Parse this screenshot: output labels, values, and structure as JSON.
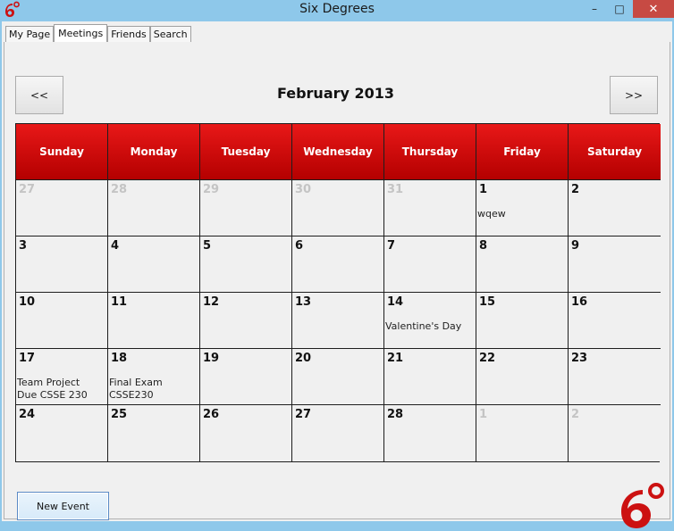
{
  "window": {
    "title": "Six Degrees"
  },
  "colors": {
    "header_red": "#d40c0c",
    "brand_red": "#cc1111"
  },
  "tabs": [
    {
      "label": "My Page",
      "active": false
    },
    {
      "label": "Meetings",
      "active": true
    },
    {
      "label": "Friends",
      "active": false
    },
    {
      "label": "Search",
      "active": false
    }
  ],
  "calendar": {
    "prev_label": "<<",
    "next_label": ">>",
    "month_title": "February 2013",
    "weekdays": [
      "Sunday",
      "Monday",
      "Tuesday",
      "Wednesday",
      "Thursday",
      "Friday",
      "Saturday"
    ],
    "weeks": [
      [
        {
          "day": "27",
          "other": true,
          "event": ""
        },
        {
          "day": "28",
          "other": true,
          "event": ""
        },
        {
          "day": "29",
          "other": true,
          "event": ""
        },
        {
          "day": "30",
          "other": true,
          "event": ""
        },
        {
          "day": "31",
          "other": true,
          "event": ""
        },
        {
          "day": "1",
          "other": false,
          "event": "wqew"
        },
        {
          "day": "2",
          "other": false,
          "event": ""
        }
      ],
      [
        {
          "day": "3",
          "other": false,
          "event": ""
        },
        {
          "day": "4",
          "other": false,
          "event": ""
        },
        {
          "day": "5",
          "other": false,
          "event": ""
        },
        {
          "day": "6",
          "other": false,
          "event": ""
        },
        {
          "day": "7",
          "other": false,
          "event": ""
        },
        {
          "day": "8",
          "other": false,
          "event": ""
        },
        {
          "day": "9",
          "other": false,
          "event": ""
        }
      ],
      [
        {
          "day": "10",
          "other": false,
          "event": ""
        },
        {
          "day": "11",
          "other": false,
          "event": ""
        },
        {
          "day": "12",
          "other": false,
          "event": ""
        },
        {
          "day": "13",
          "other": false,
          "event": ""
        },
        {
          "day": "14",
          "other": false,
          "event": "Valentine's Day"
        },
        {
          "day": "15",
          "other": false,
          "event": ""
        },
        {
          "day": "16",
          "other": false,
          "event": ""
        }
      ],
      [
        {
          "day": "17",
          "other": false,
          "event": "Team Project\nDue CSSE 230"
        },
        {
          "day": "18",
          "other": false,
          "event": "Final Exam\nCSSE230"
        },
        {
          "day": "19",
          "other": false,
          "event": ""
        },
        {
          "day": "20",
          "other": false,
          "event": ""
        },
        {
          "day": "21",
          "other": false,
          "event": ""
        },
        {
          "day": "22",
          "other": false,
          "event": ""
        },
        {
          "day": "23",
          "other": false,
          "event": ""
        }
      ],
      [
        {
          "day": "24",
          "other": false,
          "event": ""
        },
        {
          "day": "25",
          "other": false,
          "event": ""
        },
        {
          "day": "26",
          "other": false,
          "event": ""
        },
        {
          "day": "27",
          "other": false,
          "event": ""
        },
        {
          "day": "28",
          "other": false,
          "event": ""
        },
        {
          "day": "1",
          "other": true,
          "event": ""
        },
        {
          "day": "2",
          "other": true,
          "event": ""
        }
      ]
    ]
  },
  "actions": {
    "new_event_label": "New Event"
  },
  "icons": {
    "app": "six-degrees-logo-icon",
    "brand": "six-degrees-logo-icon"
  }
}
